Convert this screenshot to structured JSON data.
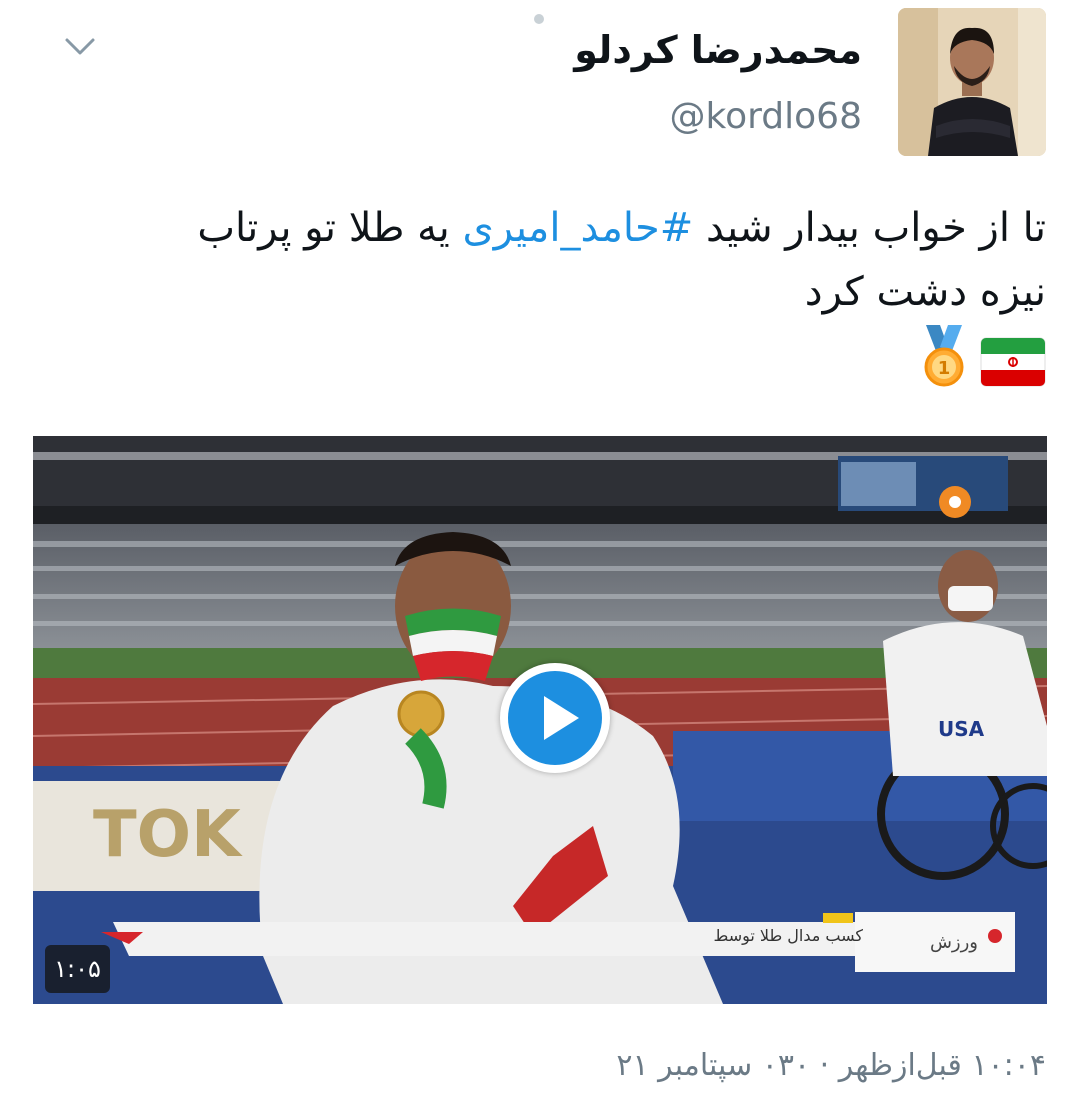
{
  "author": {
    "display_name": "محمدرضا کردلو",
    "handle": "@kordlo68"
  },
  "tweet": {
    "text_before": "تا از خواب بیدار شید ",
    "hashtag": "#حامد_امیری",
    "text_after": " یه طلا تو پرتاب نیزه دشت کرد",
    "emojis": [
      "iran-flag-icon",
      "gold-medal-icon"
    ]
  },
  "video": {
    "duration": "۱:۰۵",
    "caption_strip": "کسب مدال طلا توسط",
    "channel_logo": "ورزش",
    "stadium_text": "TOK",
    "jersey_text": "USA"
  },
  "timestamp": "۱۰:۰۴ قبل‌ازظهر · ۰۳۰ سپتامبر ۲۱",
  "colors": {
    "hashtag": "#1d8fe0",
    "meta_text": "#6b7a86",
    "play_accent": "#1d8fe0"
  }
}
